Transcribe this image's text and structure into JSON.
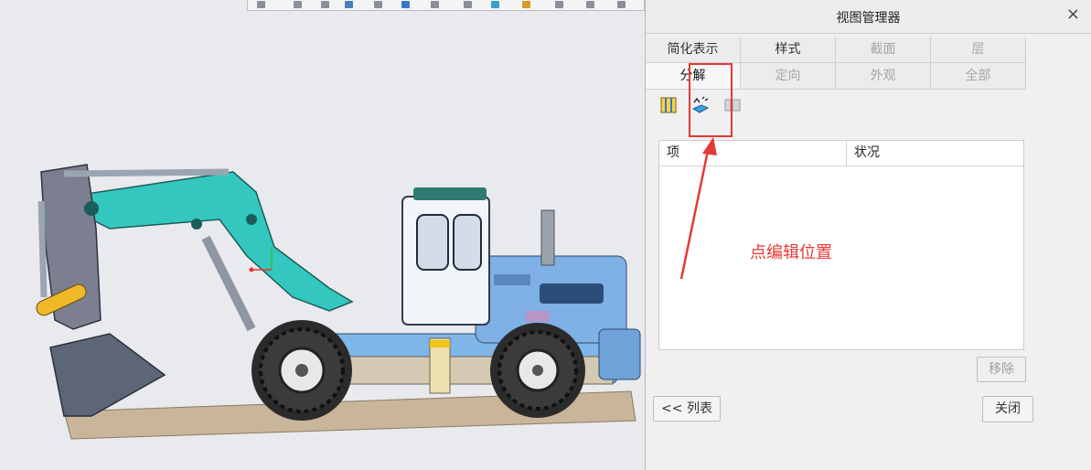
{
  "dialog": {
    "title": "视图管理器",
    "close_glyph": "×",
    "tabs_row1": [
      "简化表示",
      "样式",
      "截面",
      "层"
    ],
    "tabs_row2": [
      "分解",
      "定向",
      "外观",
      "全部"
    ],
    "list": {
      "headers": [
        "项",
        "状况"
      ]
    },
    "buttons": {
      "remove": "移除",
      "list": "<< 列表",
      "close": "关闭"
    }
  },
  "annotation": {
    "text": "点编辑位置",
    "color": "#e53935"
  },
  "icons": {
    "new": "explode-new-icon",
    "edit": "edit-position-icon",
    "properties": "properties-icon"
  }
}
